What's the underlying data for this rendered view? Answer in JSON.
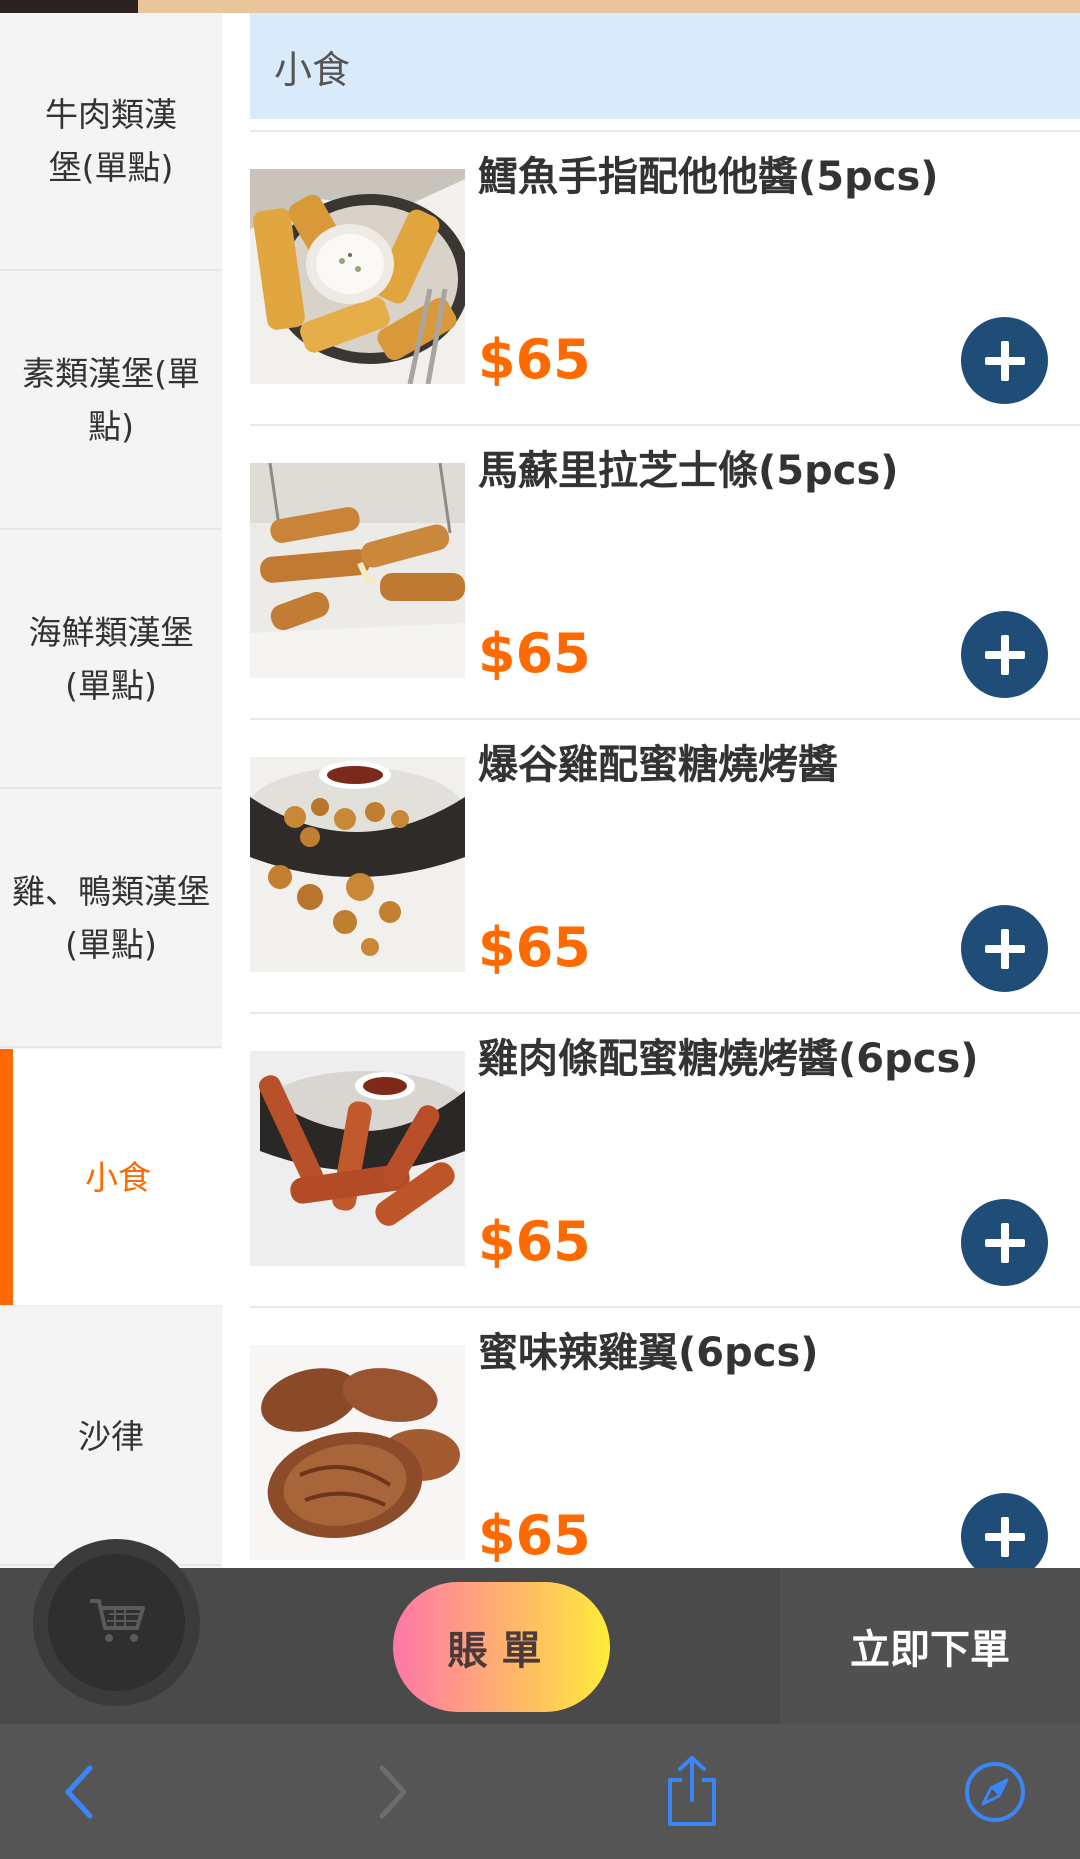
{
  "sidebar": {
    "items": [
      {
        "label": "牛肉類漢堡(單點)"
      },
      {
        "label": "素類漢堡(單點)"
      },
      {
        "label": "海鮮類漢堡(單點)"
      },
      {
        "label": "雞、鴨類漢堡(單點)"
      },
      {
        "label": "小食",
        "active": true
      },
      {
        "label": "沙律"
      }
    ]
  },
  "category": {
    "title": "小食"
  },
  "products": [
    {
      "name": "鱈魚手指配他他醬(5pcs)",
      "price": "$65",
      "image": "fish-fingers-photo"
    },
    {
      "name": "馬蘇里拉芝士條(5pcs)",
      "price": "$65",
      "image": "mozzarella-sticks-photo"
    },
    {
      "name": "爆谷雞配蜜糖燒烤醬",
      "price": "$65",
      "image": "popcorn-chicken-photo"
    },
    {
      "name": "雞肉條配蜜糖燒烤醬(6pcs)",
      "price": "$65",
      "image": "chicken-strips-photo"
    },
    {
      "name": "蜜味辣雞翼(6pcs)",
      "price": "$65",
      "image": "spicy-wings-photo"
    }
  ],
  "action_bar": {
    "cart_icon": "shopping-cart-icon",
    "bill_label": "賬單",
    "order_label": "立即下單"
  },
  "browser_toolbar": {
    "icons": [
      "back-icon",
      "forward-icon",
      "share-icon",
      "compass-icon"
    ]
  },
  "colors": {
    "accent": "#ff6a00",
    "add_button": "#1f4d78",
    "header_bg": "#d9ebfb",
    "browser_icon": "#3b86f7"
  }
}
